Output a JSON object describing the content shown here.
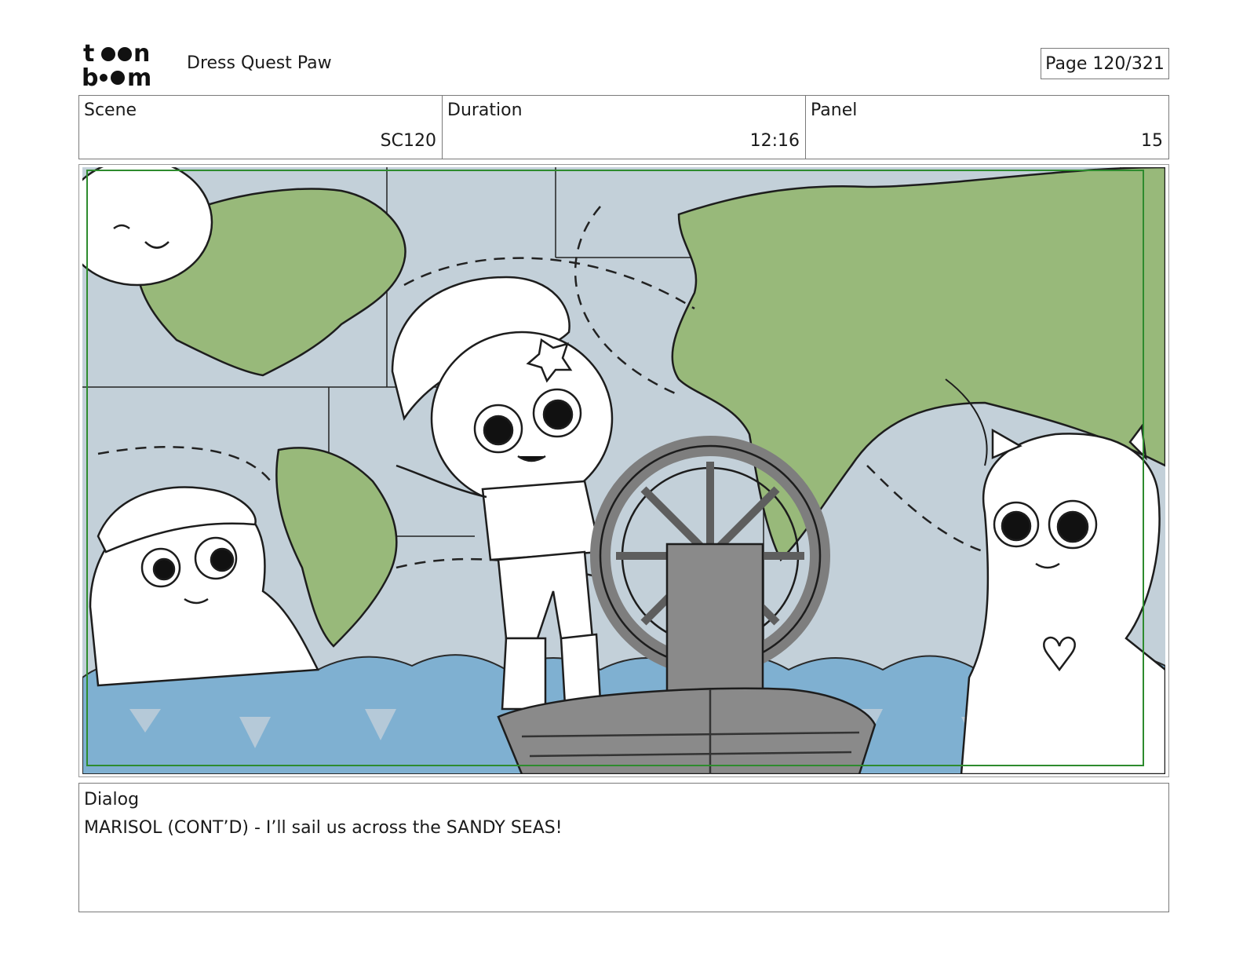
{
  "header": {
    "logo_text_top": "toon",
    "logo_text_bottom": "boom",
    "project_title": "Dress Quest Paw",
    "page_indicator": "Page 120/321"
  },
  "info": {
    "scene_label": "Scene",
    "scene_value": "SC120",
    "duration_label": "Duration",
    "duration_value": "12:16",
    "panel_label": "Panel",
    "panel_value": "15"
  },
  "dialog": {
    "label": "Dialog",
    "text": "MARISOL (CONT’D) - I’ll sail us across the SANDY SEAS!"
  },
  "colors": {
    "sea_map": "#c3d0d9",
    "land": "#98b97a",
    "water": "#7fb0d1",
    "boat": "#8a8a8a",
    "safe_frame": "#2e8b2e"
  }
}
